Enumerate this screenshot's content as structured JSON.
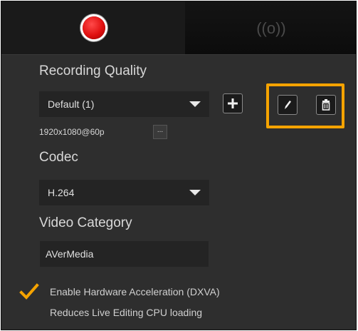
{
  "tabs": [
    {
      "name": "record",
      "icon": "record-dot-icon",
      "active": true
    },
    {
      "name": "stream",
      "icon": "broadcast-icon",
      "active": false,
      "glyph": "((o))"
    }
  ],
  "recording_quality": {
    "label": "Recording Quality",
    "selected": "Default (1)",
    "resolution": "1920x1080@60p",
    "more_glyph": "...",
    "add_icon": "plus-icon",
    "edit_icon": "pencil-icon",
    "delete_icon": "trash-icon"
  },
  "codec": {
    "label": "Codec",
    "selected": "H.264"
  },
  "video_category": {
    "label": "Video Category",
    "value": "AVerMedia"
  },
  "hardware_acceleration": {
    "checked": true,
    "label": "Enable Hardware Acceleration (DXVA)",
    "note": "Reduces Live Editing CPU loading"
  },
  "colors": {
    "highlight": "#f5a300",
    "record": "#e01010",
    "panel": "#2e2e2e"
  }
}
